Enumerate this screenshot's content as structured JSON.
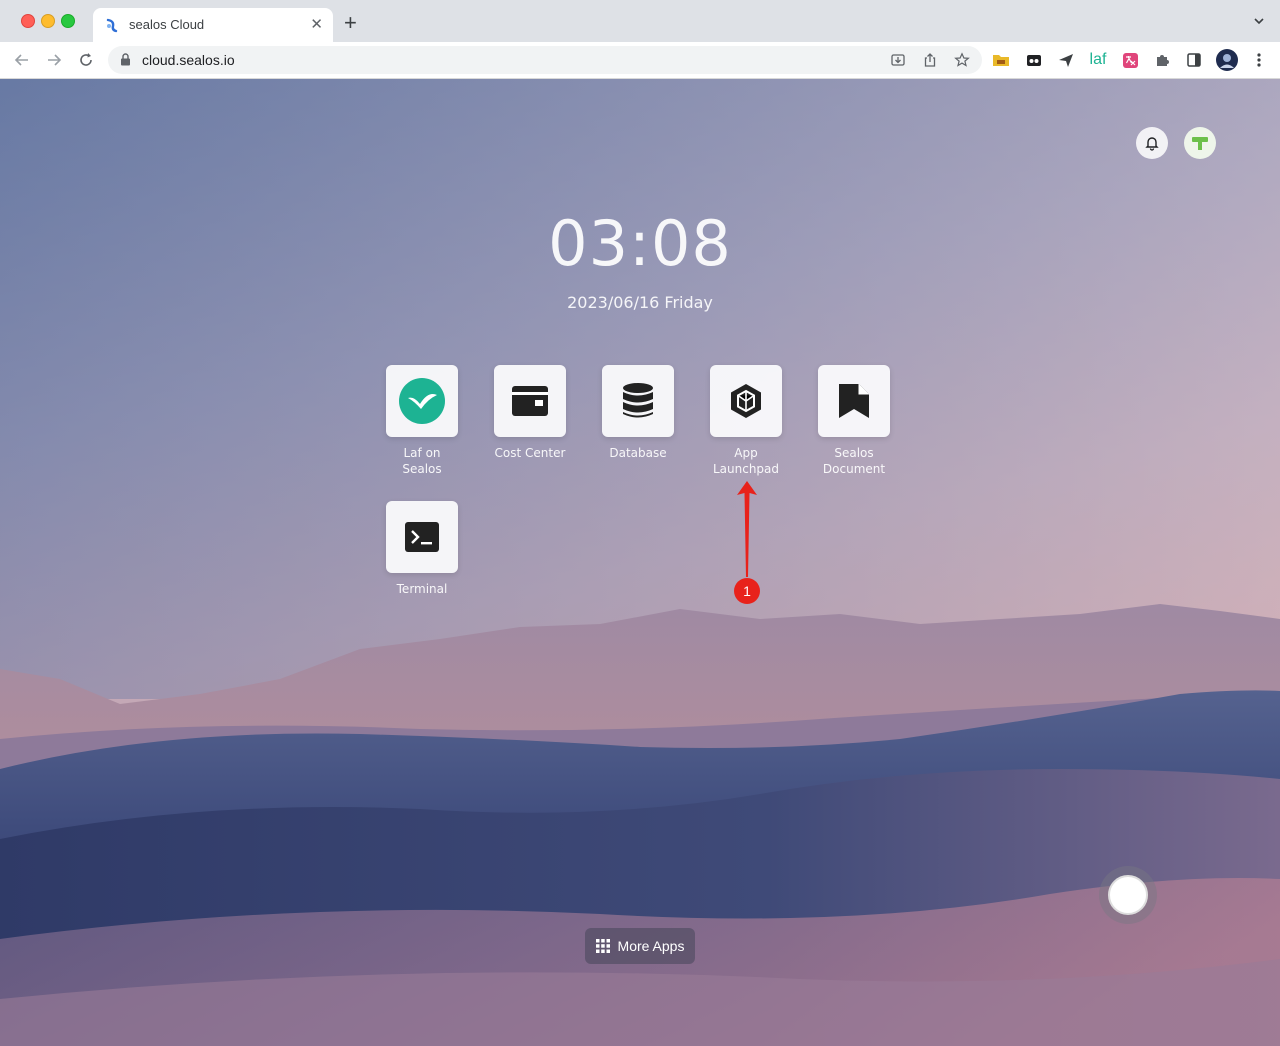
{
  "browser": {
    "tab_title": "sealos Cloud",
    "url": "cloud.sealos.io",
    "new_tab_label": "+",
    "tab_close_label": "✕"
  },
  "extensions": [
    "laf"
  ],
  "desktop": {
    "time": "03:08",
    "date": "2023/06/16 Friday",
    "apps": [
      {
        "label_line1": "Laf on",
        "label_line2": "Sealos",
        "icon": "laf-icon"
      },
      {
        "label_line1": "Cost Center",
        "label_line2": "",
        "icon": "wallet-icon"
      },
      {
        "label_line1": "Database",
        "label_line2": "",
        "icon": "database-icon"
      },
      {
        "label_line1": "App",
        "label_line2": "Launchpad",
        "icon": "hexagon-icon"
      },
      {
        "label_line1": "Sealos",
        "label_line2": "Document",
        "icon": "bookmark-doc-icon"
      },
      {
        "label_line1": "Terminal",
        "label_line2": "",
        "icon": "terminal-icon"
      }
    ],
    "annotation_badge": "1",
    "more_apps_label": "More Apps"
  },
  "colors": {
    "laf_teal": "#1db393",
    "badge_red": "#e8221b"
  }
}
